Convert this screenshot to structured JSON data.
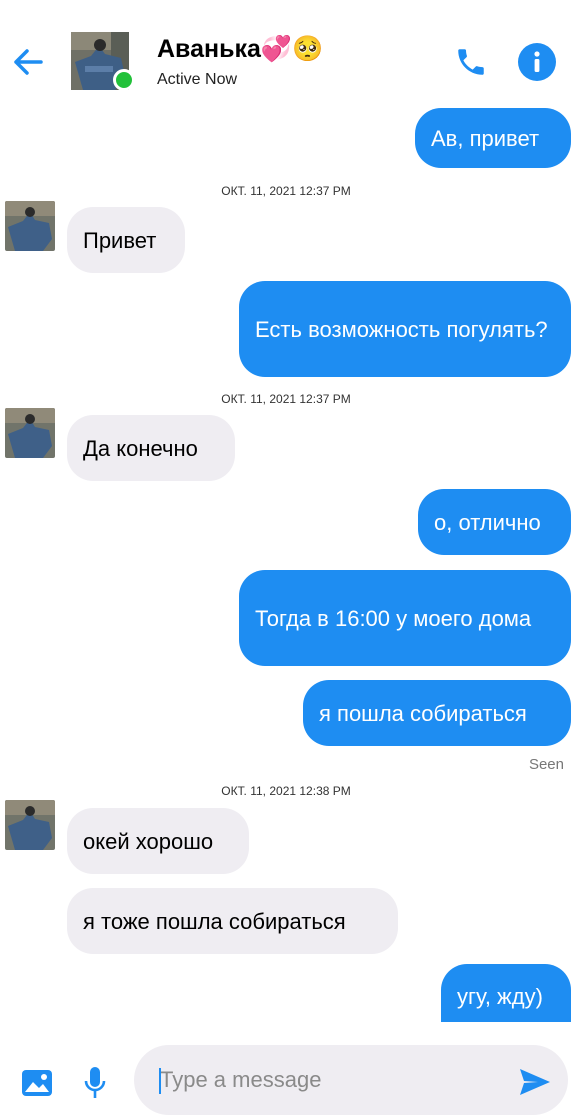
{
  "header": {
    "contact_name": "Аванька",
    "name_emoji": "💞🥺",
    "status": "Active Now"
  },
  "messages": [
    {
      "text": "Ав, привет"
    },
    {
      "timestamp": "ОКТ. 11, 2021 12:37 PM"
    },
    {
      "text": "Привет"
    },
    {
      "text": "Есть возможность погулять?"
    },
    {
      "timestamp": "ОКТ. 11, 2021 12:37 PM"
    },
    {
      "text": "Да конечно"
    },
    {
      "text": "о, отлично"
    },
    {
      "text": "Тогда в 16:00 у моего дома"
    },
    {
      "text": "я пошла собираться"
    },
    {
      "seen": "Seen"
    },
    {
      "timestamp": "ОКТ. 11, 2021 12:38 PM"
    },
    {
      "text": "окей хорошо"
    },
    {
      "text": "я тоже пошла собираться"
    },
    {
      "text": "угу, жду)"
    }
  ],
  "composer": {
    "placeholder": "Type a message"
  },
  "colors": {
    "accent": "#1e8df2",
    "incoming_bubble": "#efedf2",
    "online": "#22c13a"
  },
  "icons": [
    "back-arrow-icon",
    "phone-icon",
    "info-icon",
    "image-icon",
    "microphone-icon",
    "send-icon"
  ]
}
